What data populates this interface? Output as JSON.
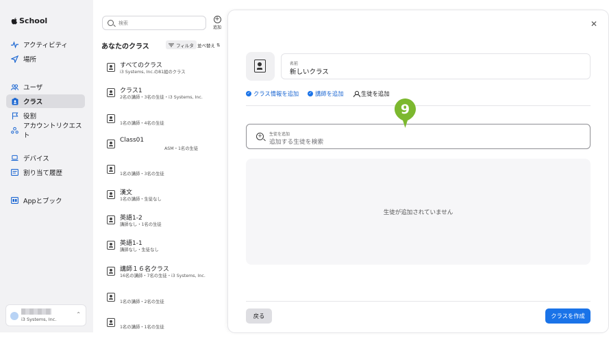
{
  "app": {
    "name": "School"
  },
  "sidebar": {
    "items": [
      {
        "label": "アクティビティ",
        "icon": "activity-icon"
      },
      {
        "label": "場所",
        "icon": "location-icon"
      },
      {
        "label": "ユーザ",
        "icon": "users-icon"
      },
      {
        "label": "クラス",
        "icon": "class-icon",
        "active": true
      },
      {
        "label": "役割",
        "icon": "flag-icon"
      },
      {
        "label": "アカウントリクエスト",
        "icon": "account-request-icon"
      },
      {
        "label": "デバイス",
        "icon": "laptop-icon"
      },
      {
        "label": "割り当て履歴",
        "icon": "history-icon"
      },
      {
        "label": "Appとブック",
        "icon": "apps-books-icon"
      }
    ],
    "account": {
      "org": "i3 Systems, Inc."
    }
  },
  "list": {
    "search_placeholder": "検索",
    "add_label": "追加",
    "title": "あなたのクラス",
    "filter_label": "フィルタ",
    "sort_label": "並べ替え",
    "rows": [
      {
        "title": "すべてのクラス",
        "subtitle": "i3 Systems, Inc.の81組のクラス"
      },
      {
        "title": "クラス1",
        "subtitle": "2名の講師・3名の生徒・i3 Systems, Inc."
      },
      {
        "title": "",
        "subtitle": "1名の講師・4名の生徒"
      },
      {
        "title": "Class01",
        "subtitle": "ASM・1名の生徒"
      },
      {
        "title": "",
        "subtitle": "1名の講師・3名の生徒"
      },
      {
        "title": "漢文",
        "subtitle": "1名の講師・生徒なし"
      },
      {
        "title": "英語1-2",
        "subtitle": "講師なし・1名の生徒"
      },
      {
        "title": "英語1-1",
        "subtitle": "講師なし・生徒なし"
      },
      {
        "title": "講師１６名クラス",
        "subtitle": "16名の講師・7名の生徒・i3 Systems, Inc."
      },
      {
        "title": "",
        "subtitle": "1名の講師・2名の生徒"
      },
      {
        "title": "",
        "subtitle": "1名の講師・1名の生徒"
      }
    ]
  },
  "panel": {
    "name_label": "名前",
    "name_value": "新しいクラス",
    "steps": [
      {
        "label": "クラス情報を追加",
        "done": true
      },
      {
        "label": "講師を追加",
        "done": true
      },
      {
        "label": "生徒を追加",
        "done": false
      }
    ],
    "add_student_label": "生徒を追加",
    "add_student_placeholder": "追加する生徒を検索",
    "empty_text": "生徒が追加されていません",
    "back_label": "戻る",
    "create_label": "クラスを作成"
  },
  "marker": {
    "number": "9",
    "color": "#7cb82f"
  },
  "colors": {
    "accent": "#1a73e8",
    "sidebar_bg": "#f2f2f4"
  }
}
